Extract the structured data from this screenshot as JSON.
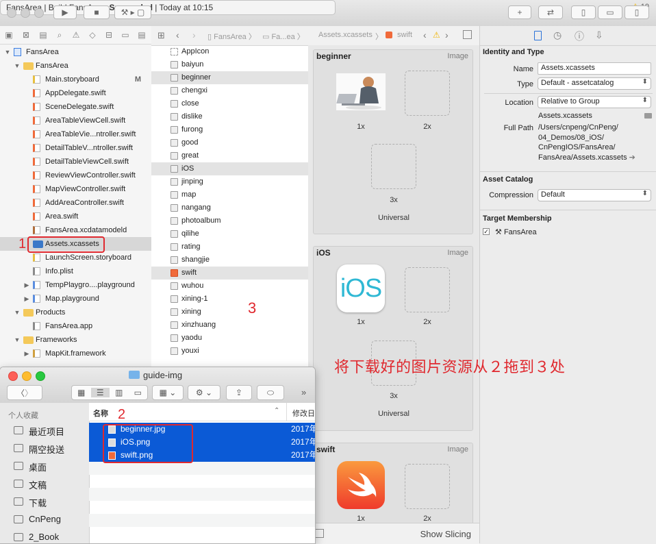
{
  "toolbar": {
    "scheme": "FansArea",
    "status_prefix": "FansArea | Build FansArea: ",
    "status_bold": "Succeeded",
    "status_suffix": " | Today at 10:15",
    "warning_count": "10"
  },
  "navigator": {
    "items": [
      {
        "label": "FansArea",
        "indent": 0,
        "kind": "project",
        "open": true
      },
      {
        "label": "FansArea",
        "indent": 1,
        "kind": "folder",
        "open": true
      },
      {
        "label": "Main.storyboard",
        "indent": 2,
        "kind": "storyboard",
        "badge": "M"
      },
      {
        "label": "AppDelegate.swift",
        "indent": 2,
        "kind": "swift"
      },
      {
        "label": "SceneDelegate.swift",
        "indent": 2,
        "kind": "swift"
      },
      {
        "label": "AreaTableViewCell.swift",
        "indent": 2,
        "kind": "swift"
      },
      {
        "label": "AreaTableVie...ntroller.swift",
        "indent": 2,
        "kind": "swift"
      },
      {
        "label": "DetailTableV...ntroller.swift",
        "indent": 2,
        "kind": "swift"
      },
      {
        "label": "DetailTableViewCell.swift",
        "indent": 2,
        "kind": "swift"
      },
      {
        "label": "ReviewViewController.swift",
        "indent": 2,
        "kind": "swift"
      },
      {
        "label": "MapViewController.swift",
        "indent": 2,
        "kind": "swift"
      },
      {
        "label": "AddAreaController.swift",
        "indent": 2,
        "kind": "swift"
      },
      {
        "label": "Area.swift",
        "indent": 2,
        "kind": "swift"
      },
      {
        "label": "FansArea.xcdatamodeld",
        "indent": 2,
        "kind": "model"
      },
      {
        "label": "Assets.xcassets",
        "indent": 2,
        "kind": "assets",
        "selected": true
      },
      {
        "label": "LaunchScreen.storyboard",
        "indent": 2,
        "kind": "storyboard"
      },
      {
        "label": "Info.plist",
        "indent": 2,
        "kind": "plist"
      },
      {
        "label": "TempPlaygro....playground",
        "indent": 2,
        "kind": "playground",
        "closed": true
      },
      {
        "label": "Map.playground",
        "indent": 2,
        "kind": "playground",
        "closed": true
      },
      {
        "label": "Products",
        "indent": 1,
        "kind": "folder",
        "open": true
      },
      {
        "label": "FansArea.app",
        "indent": 2,
        "kind": "app"
      },
      {
        "label": "Frameworks",
        "indent": 1,
        "kind": "folder",
        "open": true
      },
      {
        "label": "MapKit.framework",
        "indent": 2,
        "kind": "framework",
        "closed": true
      }
    ]
  },
  "jumpbar": {
    "crumbs": [
      "FansArea",
      "Fa...ea",
      "Assets.xcassets",
      "swift"
    ]
  },
  "assets": {
    "items": [
      {
        "label": "AppIcon"
      },
      {
        "label": "baiyun"
      },
      {
        "label": "beginner",
        "highlight": true
      },
      {
        "label": "chengxi"
      },
      {
        "label": "close"
      },
      {
        "label": "dislike"
      },
      {
        "label": "furong"
      },
      {
        "label": "good"
      },
      {
        "label": "great"
      },
      {
        "label": "iOS",
        "highlight": true
      },
      {
        "label": "jinping"
      },
      {
        "label": "map"
      },
      {
        "label": "nangang"
      },
      {
        "label": "photoalbum"
      },
      {
        "label": "qilihe"
      },
      {
        "label": "rating"
      },
      {
        "label": "shangjie"
      },
      {
        "label": "swift",
        "highlight": true
      },
      {
        "label": "wuhou"
      },
      {
        "label": "xining-1"
      },
      {
        "label": "xining"
      },
      {
        "label": "xinzhuang"
      },
      {
        "label": "yaodu"
      },
      {
        "label": "youxi"
      }
    ]
  },
  "canvas": {
    "groups": [
      {
        "title": "beginner",
        "kind": "Image",
        "one": "1x",
        "two": "2x",
        "three": "3x",
        "footer": "Universal"
      },
      {
        "title": "iOS",
        "kind": "Image",
        "one": "1x",
        "two": "2x",
        "three": "3x",
        "footer": "Universal",
        "logo": "iOS"
      },
      {
        "title": "swift",
        "kind": "Image",
        "one": "1x",
        "two": "2x"
      }
    ],
    "show_slicing": "Show Slicing"
  },
  "inspector": {
    "identity_title": "Identity and Type",
    "name_label": "Name",
    "name_value": "Assets.xcassets",
    "type_label": "Type",
    "type_value": "Default - assetcatalog",
    "location_label": "Location",
    "location_value": "Relative to Group",
    "location_file": "Assets.xcassets",
    "fullpath_label": "Full Path",
    "fullpath_lines": [
      "/Users/cnpeng/CnPeng/",
      "04_Demos/08_iOS/",
      "CnPengIOS/FansArea/",
      "FansArea/Assets.xcassets"
    ],
    "catalog_title": "Asset Catalog",
    "compression_label": "Compression",
    "compression_value": "Default",
    "membership_title": "Target Membership",
    "membership_target": "FansArea"
  },
  "finder": {
    "title": "guide-img",
    "sidebar_header": "个人收藏",
    "sidebar_items": [
      "最近项目",
      "隔空投送",
      "桌面",
      "文稿",
      "下载",
      "CnPeng",
      "2_Book"
    ],
    "col_name": "名称",
    "col_date": "修改日",
    "files": [
      {
        "name": "beginner.jpg",
        "date": "2017年"
      },
      {
        "name": "iOS.png",
        "date": "2017年"
      },
      {
        "name": "swift.png",
        "date": "2017年"
      }
    ]
  },
  "annotations": {
    "step1": "1",
    "step2": "2",
    "step3": "3",
    "instruction": "将下载好的图片资源从２拖到３处"
  },
  "colors": {
    "accent": "#0b5ad6",
    "annotation_red": "#e0282e",
    "warning": "#f0b400"
  }
}
